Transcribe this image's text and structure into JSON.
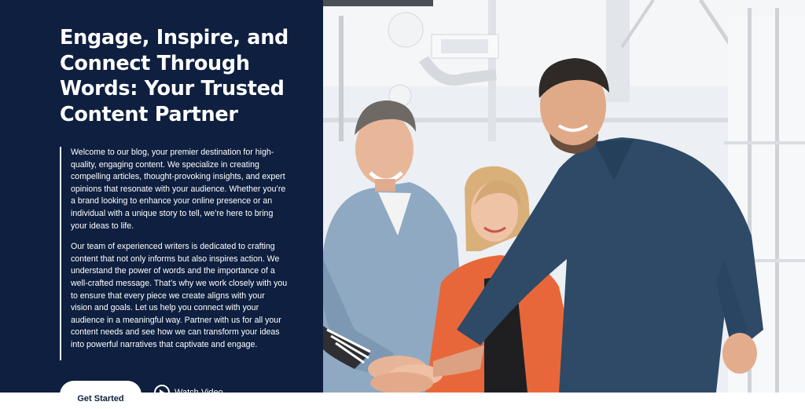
{
  "hero": {
    "headline": "Engage, Inspire, and Connect Through Words: Your Trusted Content Partner",
    "paragraph_1": "Welcome to our blog, your premier destination for high-quality, engaging content. We specialize in creating compelling articles, thought-provoking insights, and expert opinions that resonate with your audience. Whether you’re a brand looking to enhance your online presence or an individual with a unique story to tell, we’re here to bring your ideas to life.",
    "paragraph_2": "Our team of experienced writers is dedicated to crafting content that not only informs but also inspires action. We understand the power of words and the importance of a well-crafted message. That’s why we work closely with you to ensure that every piece we create aligns with your vision and goals. Let us help you connect with your audience in a meaningful way. Partner with us for all your content needs and see how we can transform your ideas into powerful narratives that captivate and engage.",
    "cta_label": "Get Started",
    "watch_label": "Watch Video"
  },
  "colors": {
    "panel_background": "#0e1f3f",
    "text": "#ffffff"
  },
  "icons": {
    "watch": "play-circle-icon"
  }
}
